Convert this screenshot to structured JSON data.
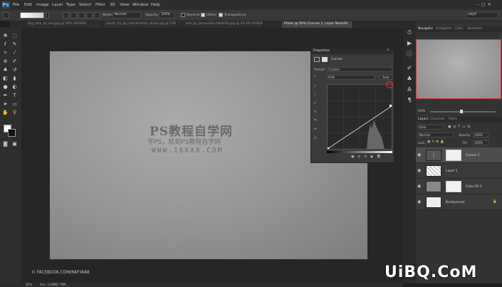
{
  "app": {
    "logo": "Ps"
  },
  "menu": [
    "File",
    "Edit",
    "Image",
    "Layer",
    "Type",
    "Select",
    "Filter",
    "3D",
    "View",
    "Window",
    "Help"
  ],
  "options": {
    "mode_label": "Mode:",
    "mode_value": "Normal",
    "opacity_label": "Opacity:",
    "opacity_value": "100%",
    "reverse": "Reverse",
    "dither": "Dither",
    "transparency": "Transparency",
    "workspace": "rafyA"
  },
  "tabs": [
    "big_rock_at_sea.jpg @ 50% (RGB/8)",
    "photo_01_by_hendricklee_stock.jpg @ 13% (RGB/8)",
    "sea_by_bennyblo-d3b4f3a.jpg @ 33.3% (RGB/8)",
    "Photo @ 50% (Curves 1, Layer Mask/8)"
  ],
  "canvas": {
    "wm_title": "PS教程自学网",
    "wm_sub": "学PS，就到PS教程自学网",
    "wm_url": "WWW.16XX8.COM",
    "credit": "© FACEBOOK.COM/RAFYA88"
  },
  "properties": {
    "title": "Properties",
    "panel_name": "Curves",
    "preset_label": "Preset:",
    "preset_value": "Custom",
    "channel_value": "RGB",
    "auto": "Auto"
  },
  "navigator": {
    "tabs": [
      "Navigator",
      "Histogram",
      "Color",
      "Swatches"
    ],
    "zoom": "50%"
  },
  "layers": {
    "tabs": [
      "Layers",
      "Channels",
      "Paths"
    ],
    "filter_value": "Kind",
    "blend_value": "Normal",
    "opacity_label": "Opacity:",
    "opacity_value": "100%",
    "lock_label": "Lock:",
    "fill_label": "Fill:",
    "fill_value": "100%",
    "items": [
      {
        "name": "Curves 1"
      },
      {
        "name": "Layer 1"
      },
      {
        "name": "Color Fill 1"
      },
      {
        "name": "Background"
      }
    ]
  },
  "status": {
    "zoom": "50%",
    "doc": "Doc: 2.64M/1.76M"
  },
  "brand": "UiBQ.CoM",
  "colors": {
    "accent_red": "#d43a3a",
    "panel": "#3a3a3a",
    "bg": "#1e1e1e"
  }
}
